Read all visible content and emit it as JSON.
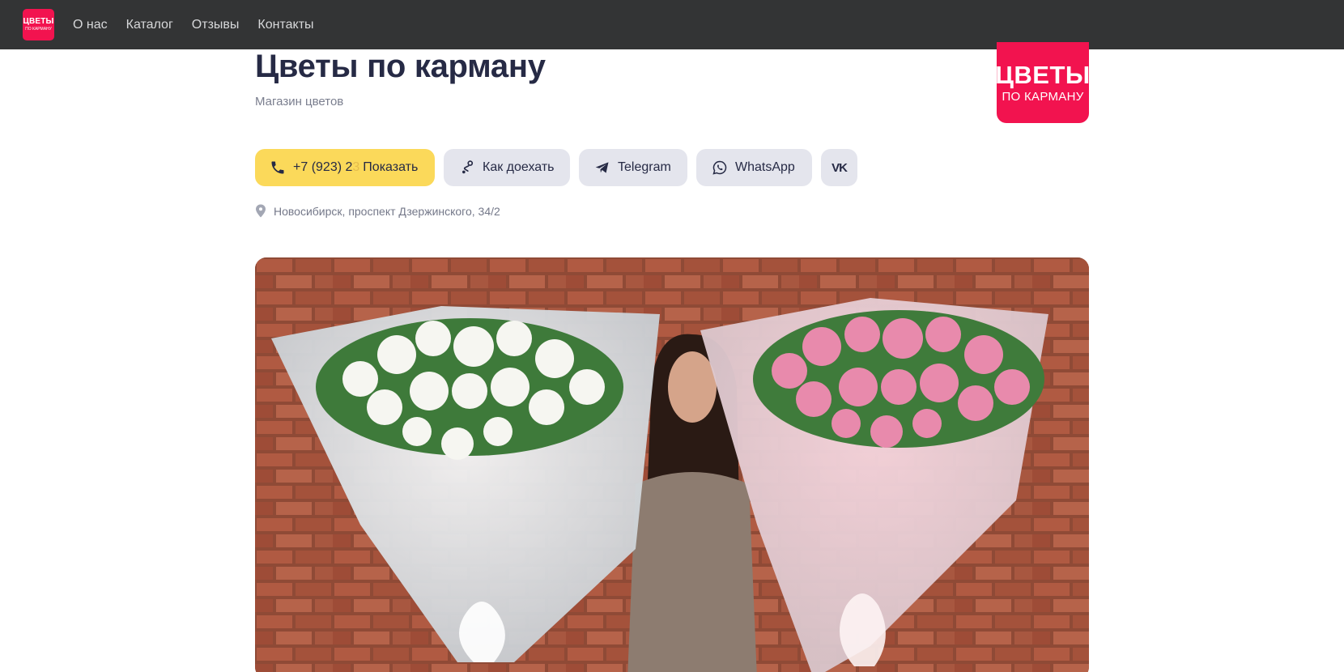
{
  "nav": {
    "logo": {
      "line1": "ЦВЕТЫ",
      "line2": "ПО КАРМАНУ"
    },
    "links": [
      "О нас",
      "Каталог",
      "Отзывы",
      "Контакты"
    ]
  },
  "header": {
    "title": "Цветы по карману",
    "subtitle": "Магазин цветов",
    "brand_logo": {
      "line1": "ЦВЕТЫ",
      "line2": "ПО КАРМАНУ"
    }
  },
  "actions": {
    "phone_number": "+7 (923) 2",
    "phone_fade": "3",
    "phone_show": "Показать",
    "route": "Как доехать",
    "telegram": "Telegram",
    "whatsapp": "WhatsApp",
    "vk": "VK"
  },
  "address": "Новосибирск, проспект Дзержинского, 34/2",
  "colors": {
    "nav_bg": "#333435",
    "brand": "#f2134f",
    "phone_button": "#fbd95a",
    "button_bg": "#e4e5ed",
    "title": "#262a45"
  },
  "icons": [
    "phone-icon",
    "route-icon",
    "telegram-icon",
    "whatsapp-icon",
    "vk-icon",
    "location-pin-icon"
  ]
}
